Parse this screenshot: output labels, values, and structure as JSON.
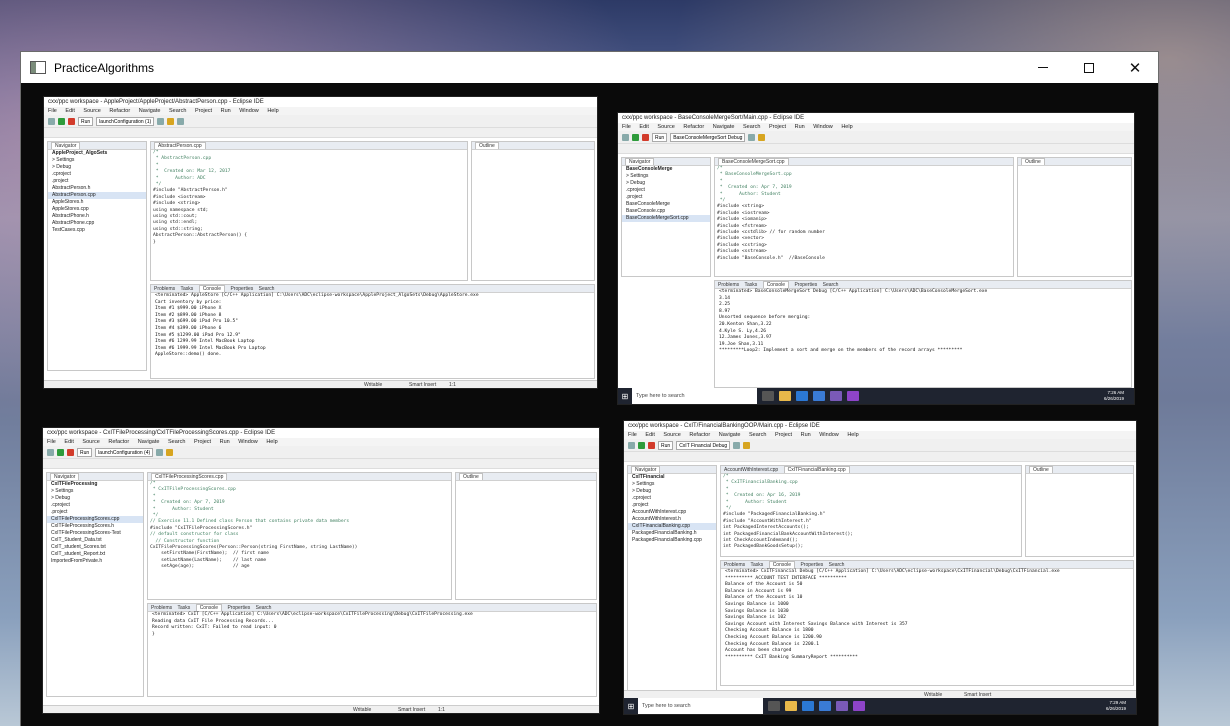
{
  "window": {
    "title": "PracticeAlgorithms",
    "minimize": "—",
    "close": "✕"
  },
  "shot1": {
    "title": "cxx/ppc workspace - AppleProject/AppleProject/AbstractPerson.cpp - Eclipse IDE",
    "menu": [
      "File",
      "Edit",
      "Source",
      "Refactor",
      "Navigate",
      "Search",
      "Project",
      "Run",
      "Window",
      "Help"
    ],
    "run_label": "Run",
    "launch_config": "launchConfiguration (1)",
    "navigator_tab": "Navigator",
    "editor_tab": "AbstractPerson.cpp",
    "outline_tab": "Outline",
    "tree": [
      "AppleProject_AlgoSets",
      "> Settings",
      "> Debug",
      "  .cproject",
      "  .project",
      "  AbstractPerson.h",
      "  AbstractPerson.cpp",
      "  AppleStores.h",
      "  AppleStores.cpp",
      "  AbstractPhone.h",
      "  AbstractPhone.cpp",
      "  TestCases.cpp"
    ],
    "code": [
      "/*",
      " * AbstractPerson.cpp",
      " *",
      " *  Created on: Mar 12, 2017",
      " *      Author: ADC",
      " */",
      "",
      "#include \"AbstractPerson.h\"",
      "#include <iostream>",
      "#include <string>",
      "using namespace std;",
      "",
      "using std::cout;",
      "using std::endl;",
      "using std::string;",
      "",
      "AbstractPerson::AbstractPerson() {",
      "}"
    ],
    "console_tabs": [
      "Problems",
      "Tasks",
      "Console",
      "Properties",
      "Search"
    ],
    "console_header": "<terminated> AppleStore [C/C++ Application] C:\\Users\\ADC\\eclipse-workspace\\AppleProject_AlgoSets\\Debug\\AppleStore.exe",
    "console": [
      "Cart inventory by price:",
      "Item #1 $999.00 iPhone X",
      "Item #2 $899.00 iPhone 8",
      "Item #3 $699.00 iPad Pro 10.5\"",
      "Item #4 $399.00 iPhone 6",
      "Item #5 $1299.00 iPad Pro 12.9\"",
      "Item #6 1299.99 Intel MacBook Laptop",
      "Item #6 1999.99 Intel MacBook Pro Laptop",
      "",
      "AppleStore::demo() done."
    ],
    "status": [
      "Writable",
      "Smart Insert",
      "1:1"
    ]
  },
  "shot2": {
    "title": "cxx/ppc workspace - BaseConsoleMergeSort/Main.cpp - Eclipse IDE",
    "menu": [
      "File",
      "Edit",
      "Source",
      "Refactor",
      "Navigate",
      "Search",
      "Project",
      "Run",
      "Window",
      "Help"
    ],
    "run_label": "Run",
    "launch_config": "BaseConsoleMergeSort Debug",
    "navigator_tab": "Navigator",
    "editor_tab": "BaseConsoleMergeSort.cpp",
    "outline_tab": "Outline",
    "tree": [
      "BaseConsoleMerge",
      "> Settings",
      "> Debug",
      "  .cproject",
      "  .project",
      "  BaseConsoleMerge",
      "  BaseConsole.cpp",
      "  BaseConsoleMergeSort.cpp"
    ],
    "code": [
      "/*",
      " * BaseConsoleMergeSort.cpp",
      " *",
      " *  Created on: Apr 7, 2019",
      " *      Author: Student",
      " */",
      "",
      "#include <string>",
      "#include <iostream>",
      "#include <iomanip>",
      "#include <fstream>",
      "#include <cstdlib> // for random number",
      "#include <vector>",
      "#include <cstring>",
      "#include <sstream>",
      "",
      "#include \"BaseConsole.h\"  //BaseConsole"
    ],
    "console_tabs": [
      "Problems",
      "Tasks",
      "Console",
      "Properties",
      "Search"
    ],
    "console_header": "<terminated> BaseConsoleMergeSort Debug [C/C++ Application] C:\\Users\\ADC\\BaseConsoleMergeSort.exe",
    "console": [
      "3.14",
      "2.25",
      "8.97",
      "",
      "Unsorted sequence before merging:",
      "20.Kenton Shan,3.22",
      "4.Kyle S. Ly,4.26",
      "12.James Jones,3.97",
      "19.Joe Shan,3.11",
      "",
      "*********Loop2: Implement a sort and merge on the members of the record arrays *********"
    ],
    "taskbar_search": "Type here to search",
    "tray_time": "7:26 AM",
    "tray_date": "6/26/2019"
  },
  "shot3": {
    "title": "cxx/ppc workspace - CxITFileProcessing/CxITFileProcessingScores.cpp - Eclipse IDE",
    "menu": [
      "File",
      "Edit",
      "Source",
      "Refactor",
      "Navigate",
      "Search",
      "Project",
      "Run",
      "Window",
      "Help"
    ],
    "run_label": "Run",
    "launch_config": "launchConfiguration (4)",
    "navigator_tab": "Navigator",
    "editor_tab": "CxITFileProcessingScores.cpp",
    "outline_tab": "Outline",
    "tree": [
      "CxITFileProcessing",
      "> Settings",
      "> Debug",
      "  .cproject",
      "  .project",
      "  CxITFileProcessingScores.cpp",
      "  CxITFileProcessingScores.h",
      "  CxITFileProcessingScores-Test",
      "  CxIT_Student_Data.txt",
      "  CxIT_student_Scores.txt",
      "  CxIT_student_Report.txt",
      "  ImportedFromPrivate.h"
    ],
    "code": [
      "/*",
      " * CxITFileProcessingScores.cpp",
      " *",
      " *  Created on: Apr 7, 2019",
      " *      Author: Student",
      " */",
      "",
      "// Exercise 11.1 Defined class Person that contains private data members",
      "",
      "#include \"CxITFileProcessingScores.h\"",
      "",
      "// default constructor for class",
      "",
      "  // Constructor function",
      "CxITFileProcessingScores(Person::Person(string FirstName, string LastName))",
      "",
      "    setFirstName(FirstName);  // first name",
      "    setLastName(LastName);    // last name",
      "    setAge(age);              // age"
    ],
    "console_tabs": [
      "Problems",
      "Tasks",
      "Console",
      "Properties",
      "Search"
    ],
    "console_header": "<terminated> CxIT [C/C++ Application] C:\\Users\\ADC\\eclipse-workspace\\CxITFileProcessing\\Debug\\CxITFileProcessing.exe",
    "console": [
      "Reading data CxIT File Processing Records...",
      "Record written: CxIT: Failed to read input: 0",
      "}"
    ],
    "status": [
      "Writable",
      "Smart Insert",
      "1:1"
    ]
  },
  "shot4": {
    "title": "cxx/ppc workspace - CxIT/FinancialBankingOOP/Main.cpp - Eclipse IDE",
    "menu": [
      "File",
      "Edit",
      "Source",
      "Refactor",
      "Navigate",
      "Search",
      "Project",
      "Run",
      "Window",
      "Help"
    ],
    "run_label": "Run",
    "launch_config": "CxIT Financial Debug",
    "navigator_tab": "Navigator",
    "editor_tab": "CxITFinancialBanking.cpp",
    "editor_tab2": "AccountWithInterest.cpp",
    "outline_tab": "Outline",
    "tree": [
      "CxITFinancial",
      "> Settings",
      "> Debug",
      "  .cproject",
      "  .project",
      "  AccountWithInterest.cpp",
      "  AccountWithInterest.h",
      "  CxITFinancialBanking.cpp",
      "  PackagedFinancialBanking.h",
      "  PackagedFinancialBanking.cpp"
    ],
    "code": [
      "/*",
      " * CxITFinancialBanking.cpp",
      " *",
      " *  Created on: Apr 16, 2019",
      " *      Author: Student",
      " */",
      "",
      "#include \"PackagedFinancialBanking.h\"",
      "#include \"AccountWithInterest.h\"",
      "",
      "int PackagedInterestAccounts();",
      "int PackagedFinancialBankAccountWithInterest();",
      "int CheckAccountIndemand();",
      "int PackagedBankGoodsSetup();"
    ],
    "console_tabs": [
      "Problems",
      "Tasks",
      "Console",
      "Properties",
      "Search"
    ],
    "console_header": "<terminated> CxITFinancial Debug [C/C++ Application] C:\\Users\\ADC\\eclipse-workspace\\CxITFinancial\\Debug\\CxITFinancial.exe",
    "console": [
      "********** ACCOUNT TEST INTERFACE **********",
      "",
      "Balance of the Account is 50",
      "Balance in Account is 99",
      "Balance of the Account is 10",
      "Savings Balance is 1000",
      "Savings Balance is 1030",
      "Savings Balance is 102",
      "Savings Account with Interest Savings Balance with Interest is 357",
      "Checking Account Balance is 1800",
      "Checking Account Balance is 1200.90",
      "Checking Account Balance is 2200.1",
      "Account has been charged",
      "",
      "********** CxIT Banking SummaryReport **********"
    ],
    "status": [
      "Writable",
      "Smart Insert"
    ],
    "taskbar_search": "Type here to search",
    "tray_time": "7:29 AM",
    "tray_date": "6/26/2019"
  }
}
